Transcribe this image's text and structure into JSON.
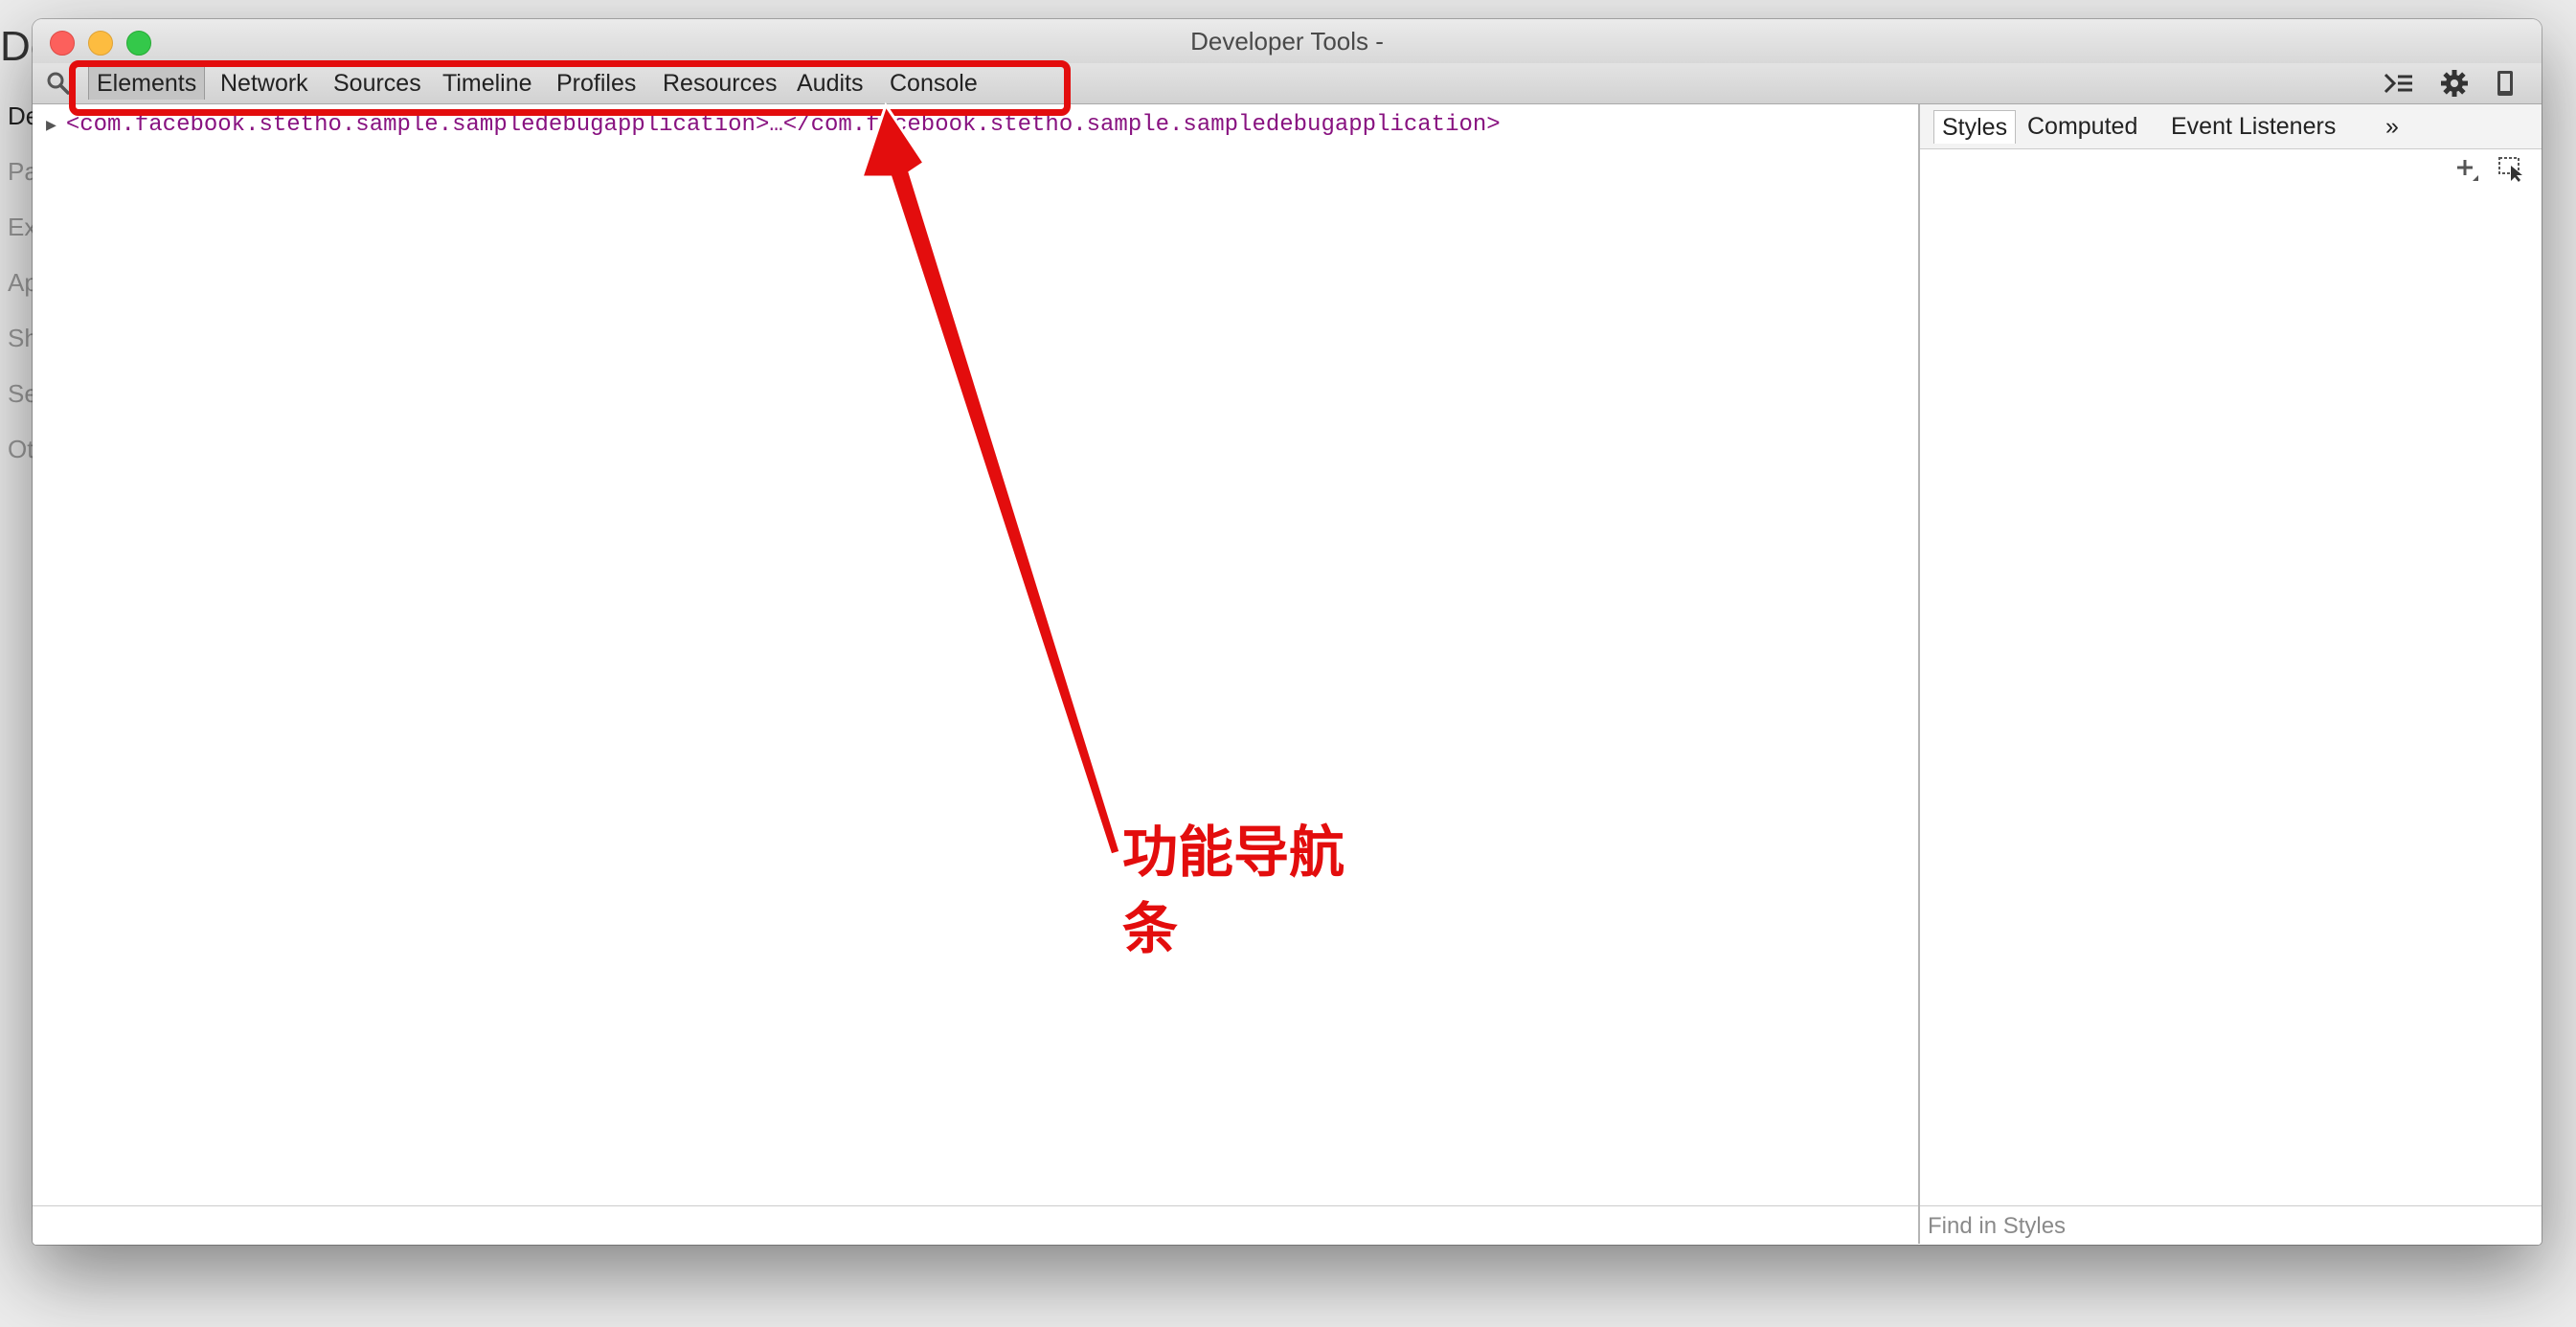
{
  "background_page": {
    "title": "De",
    "items": [
      {
        "label": "De",
        "active": true
      },
      {
        "label": "Pa",
        "active": false
      },
      {
        "label": "Ex",
        "active": false
      },
      {
        "label": "Ap",
        "active": false
      },
      {
        "label": "Sh",
        "active": false
      },
      {
        "label": "Se",
        "active": false
      },
      {
        "label": "Ot",
        "active": false
      }
    ]
  },
  "window": {
    "title": "Developer Tools -",
    "traffic_lights": {
      "close": "#fc605c",
      "minimize": "#fdbc40",
      "maximize": "#34c84a"
    }
  },
  "toolbar": {
    "search_icon": "search-icon",
    "tabs": [
      {
        "label": "Elements",
        "selected": true
      },
      {
        "label": "Network",
        "selected": false
      },
      {
        "label": "Sources",
        "selected": false
      },
      {
        "label": "Timeline",
        "selected": false
      },
      {
        "label": "Profiles",
        "selected": false
      },
      {
        "label": "Resources",
        "selected": false
      },
      {
        "label": "Audits",
        "selected": false
      },
      {
        "label": "Console",
        "selected": false
      }
    ],
    "right_icons": [
      "console-drawer-icon",
      "gear-icon",
      "device-mode-icon"
    ]
  },
  "elements_panel": {
    "dom_node": "<com.facebook.stetho.sample.sampledebugapplication>…</com.facebook.stetho.sample.sampledebugapplication>"
  },
  "sidebar": {
    "tabs": [
      {
        "label": "Styles",
        "selected": true
      },
      {
        "label": "Computed",
        "selected": false
      },
      {
        "label": "Event Listeners",
        "selected": false
      }
    ],
    "overflow_label": "»",
    "tool_icons": [
      "add-rule-icon",
      "toggle-element-state-icon"
    ],
    "find_placeholder": "Find in Styles"
  },
  "annotation": {
    "line1": "功能导航",
    "line2": "条",
    "color": "#e30d0d"
  }
}
